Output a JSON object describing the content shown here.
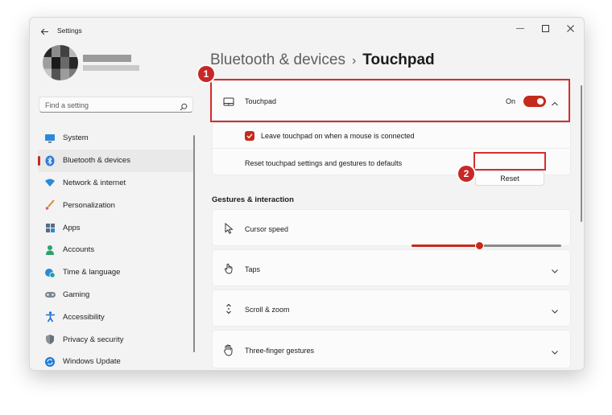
{
  "window": {
    "title": "Settings"
  },
  "window_controls": {
    "minimize": "—",
    "maximize": "☐",
    "close": "✕"
  },
  "search": {
    "placeholder": "Find a setting"
  },
  "nav": {
    "items": [
      {
        "label": "System",
        "icon": "monitor-icon",
        "active": false
      },
      {
        "label": "Bluetooth & devices",
        "icon": "bluetooth-icon",
        "active": true
      },
      {
        "label": "Network & internet",
        "icon": "wifi-icon",
        "active": false
      },
      {
        "label": "Personalization",
        "icon": "brush-icon",
        "active": false
      },
      {
        "label": "Apps",
        "icon": "apps-icon",
        "active": false
      },
      {
        "label": "Accounts",
        "icon": "person-icon",
        "active": false
      },
      {
        "label": "Time & language",
        "icon": "globe-clock-icon",
        "active": false
      },
      {
        "label": "Gaming",
        "icon": "gamepad-icon",
        "active": false
      },
      {
        "label": "Accessibility",
        "icon": "accessibility-icon",
        "active": false
      },
      {
        "label": "Privacy & security",
        "icon": "shield-icon",
        "active": false
      },
      {
        "label": "Windows Update",
        "icon": "update-icon",
        "active": false
      }
    ]
  },
  "breadcrumb": {
    "parent": "Bluetooth & devices",
    "separator": "›",
    "current": "Touchpad"
  },
  "touchpad": {
    "label": "Touchpad",
    "state_label": "On",
    "enabled": true,
    "leave_on_label": "Leave touchpad on when a mouse is connected",
    "leave_on_checked": true,
    "reset_description": "Reset touchpad settings and gestures to defaults",
    "reset_button": "Reset"
  },
  "gestures": {
    "section_title": "Gestures & interaction",
    "cursor_speed_label": "Cursor speed",
    "cursor_speed_fraction": 0.45,
    "taps_label": "Taps",
    "scroll_zoom_label": "Scroll & zoom",
    "three_finger_label": "Three-finger gestures"
  },
  "annotations": {
    "marker1": "1",
    "marker2": "2"
  },
  "colors": {
    "accent": "#c42b1c",
    "highlight": "#d32f2f"
  }
}
